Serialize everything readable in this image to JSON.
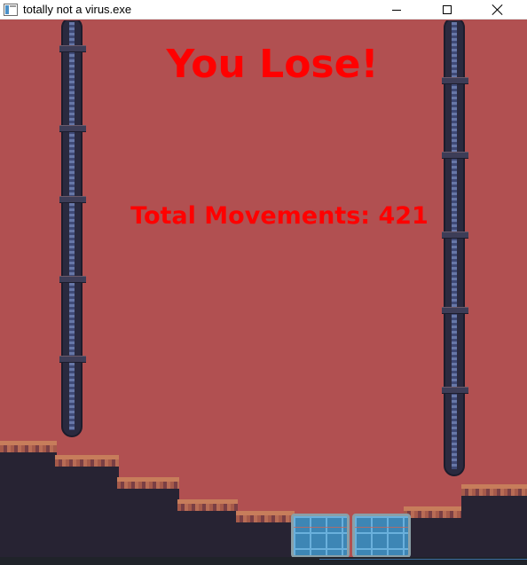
{
  "window": {
    "title": "totally not a virus.exe",
    "icon": "app-window-icon",
    "controls": [
      "minimize-icon",
      "maximize-icon",
      "close-icon"
    ]
  },
  "game": {
    "result_text": "You Lose!",
    "movements_label": "Total Movements: 421",
    "colors": {
      "background": "#b15051",
      "text": "#ff0000",
      "ground": "#272333",
      "grass": "#c77d5b",
      "water": "#3d86b5"
    }
  }
}
